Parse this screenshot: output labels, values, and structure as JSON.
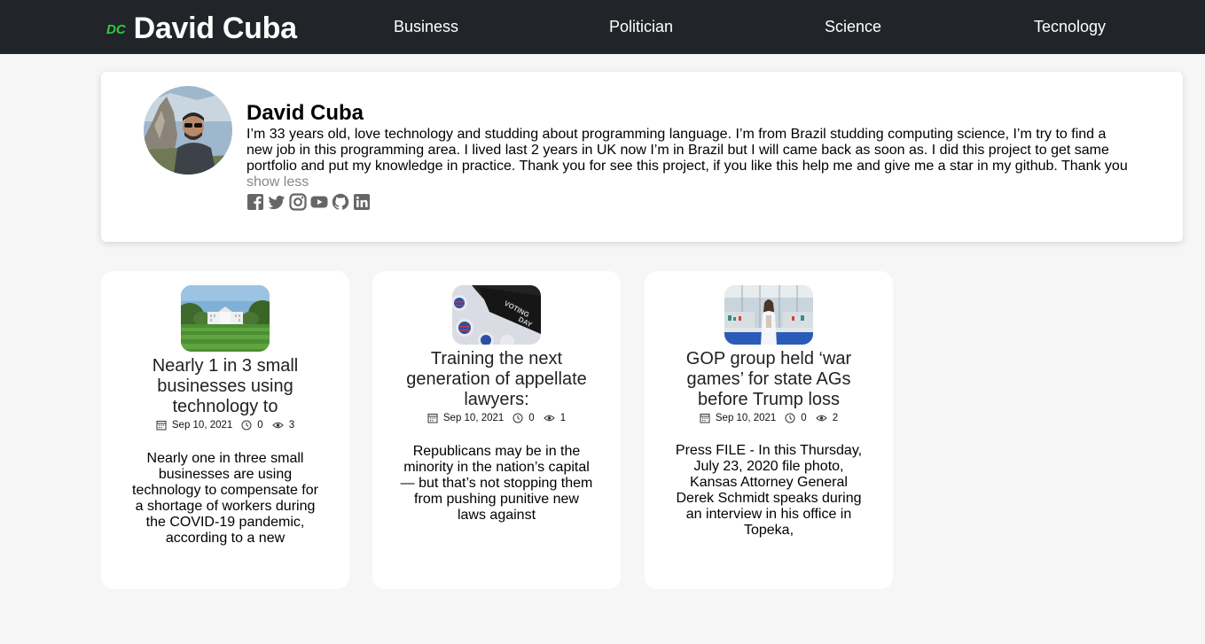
{
  "nav": {
    "logo": "DC",
    "brand": "David Cuba",
    "links": [
      "Business",
      "Politician",
      "Science",
      "Tecnology"
    ]
  },
  "profile": {
    "name": "David Cuba",
    "bio": "I’m 33 years old, love technology and studding about programming language. I’m from Brazil studding computing science, I’m try to find a new job in this programming area. I lived last 2 years in UK now I’m in Brazil but I will came back as soon as. I did this project to get same portfolio and put my knowledge in practice. Thank you for see this project, if you like this help me and give me a star in my github. Thank you",
    "show_less": "show less",
    "socials": [
      "facebook-icon",
      "twitter-icon",
      "instagram-icon",
      "youtube-icon",
      "github-icon",
      "linkedin-icon"
    ]
  },
  "cards": [
    {
      "title": "Nearly 1 in 3 small businesses using technology to",
      "date": "Sep 10, 2021",
      "comments": "0",
      "views": "3",
      "description": "Nearly one in three small businesses are using technology to compensate for a shortage of workers during the COVID-19 pandemic, according to a new"
    },
    {
      "title": "Training the next generation of appellate lawyers:",
      "date": "Sep 10, 2021",
      "comments": "0",
      "views": "1",
      "description": "Republicans may be in the minority in the nation’s capital — but that’s not stopping them from pushing punitive new laws against"
    },
    {
      "title": "GOP group held ‘war games’ for state AGs before Trump loss",
      "date": "Sep 10, 2021",
      "comments": "0",
      "views": "2",
      "description": "Press FILE - In this Thursday, July 23, 2020 file photo, Kansas Attorney General Derek Schmidt speaks during an interview in his office in Topeka,"
    }
  ],
  "colors": {
    "nav_bg": "#212529",
    "logo_green": "#2ecc40",
    "page_bg": "#f6f6f6",
    "muted": "#888888"
  }
}
